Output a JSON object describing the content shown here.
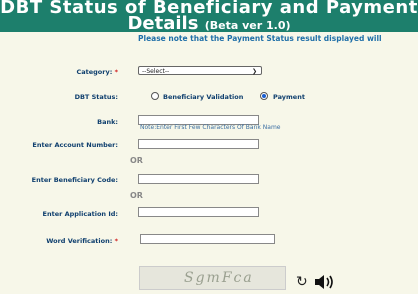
{
  "header": {
    "title_line1": "DBT Status of Beneficiary and Payment",
    "title_line2": "Details",
    "version": "(Beta ver 1.0)"
  },
  "notice": "Please note that the Payment Status result displayed will",
  "form": {
    "category_label": "Category:",
    "category_value": "--Select--",
    "dbt_status_label": "DBT Status:",
    "option_beneficiary": "Beneficiary Validation",
    "option_payment": "Payment",
    "bank_label": "Bank:",
    "bank_note": "Note:Enter First Few Characters Of Bank Name",
    "account_label": "Enter Account Number:",
    "or_1": "OR",
    "beneficiary_code_label": "Enter Beneficiary Code:",
    "or_2": "OR",
    "application_id_label": "Enter Application Id:",
    "word_verification_label": "Word Verification:",
    "required_mark": "*",
    "captcha_text": "SgmFca"
  },
  "icons": {
    "refresh": "refresh-icon",
    "audio": "speaker-icon"
  },
  "colors": {
    "header_bg": "#1d7f6c",
    "page_bg": "#f7f7e9",
    "label": "#0f3f6e",
    "notice": "#1f6fa8",
    "required": "#d02020"
  }
}
